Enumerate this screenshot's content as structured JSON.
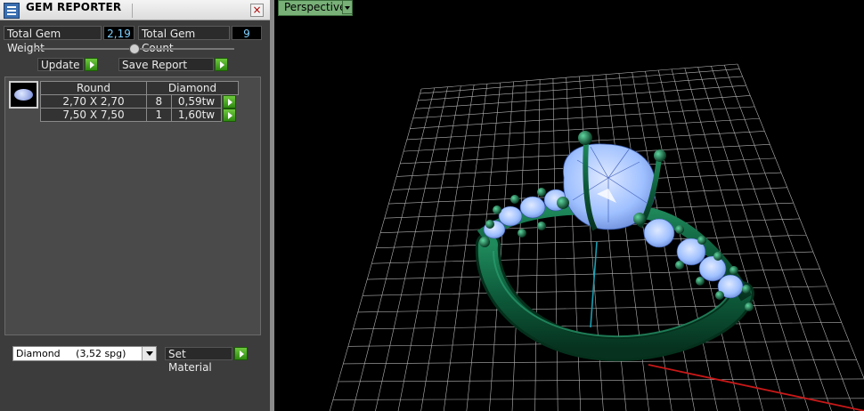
{
  "window": {
    "title": "GEM REPORTER",
    "close_glyph": "×"
  },
  "totals": {
    "weight_label": "Total Gem Weight",
    "weight_value": "2,19",
    "count_label": "Total Gem Count",
    "count_value": "9"
  },
  "actions": {
    "update_label": "Update",
    "save_label": "Save Report"
  },
  "gem_table": {
    "headers": [
      "Round",
      "Diamond"
    ],
    "rows": [
      {
        "size": "2,70 X 2,70",
        "count": "8",
        "weight": "0,59tw"
      },
      {
        "size": "7,50 X 7,50",
        "count": "1",
        "weight": "1,60tw"
      }
    ]
  },
  "material": {
    "name": "Diamond",
    "density": "(3,52 spg)",
    "set_label": "Set Material"
  },
  "viewport": {
    "label": "Perspective"
  },
  "icons": {
    "app": "gem-reporter-icon",
    "close": "close-icon",
    "arrow": "play-arrow-icon",
    "dropdown": "chevron-down-icon"
  },
  "colors": {
    "panel_bg": "#3c3c3c",
    "value_text": "#7fd0ff",
    "accent_green": "#4caf2a",
    "viewport_label": "#78b078",
    "ring_metal": "#0d5a3a",
    "gem": "#9fc0ff",
    "grid": "#b4b4b4",
    "x_axis": "#c81818",
    "y_axis": "#18a0b4"
  }
}
